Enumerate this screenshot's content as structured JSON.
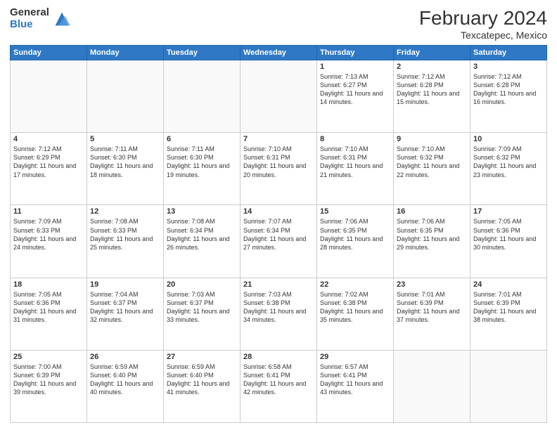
{
  "header": {
    "logo_general": "General",
    "logo_blue": "Blue",
    "month_title": "February 2024",
    "location": "Texcatepec, Mexico"
  },
  "weekdays": [
    "Sunday",
    "Monday",
    "Tuesday",
    "Wednesday",
    "Thursday",
    "Friday",
    "Saturday"
  ],
  "weeks": [
    [
      {
        "day": "",
        "sunrise": "",
        "sunset": "",
        "daylight": ""
      },
      {
        "day": "",
        "sunrise": "",
        "sunset": "",
        "daylight": ""
      },
      {
        "day": "",
        "sunrise": "",
        "sunset": "",
        "daylight": ""
      },
      {
        "day": "",
        "sunrise": "",
        "sunset": "",
        "daylight": ""
      },
      {
        "day": "1",
        "sunrise": "7:13 AM",
        "sunset": "6:27 PM",
        "daylight": "11 hours and 14 minutes."
      },
      {
        "day": "2",
        "sunrise": "7:12 AM",
        "sunset": "6:28 PM",
        "daylight": "11 hours and 15 minutes."
      },
      {
        "day": "3",
        "sunrise": "7:12 AM",
        "sunset": "6:28 PM",
        "daylight": "11 hours and 16 minutes."
      }
    ],
    [
      {
        "day": "4",
        "sunrise": "7:12 AM",
        "sunset": "6:29 PM",
        "daylight": "11 hours and 17 minutes."
      },
      {
        "day": "5",
        "sunrise": "7:11 AM",
        "sunset": "6:30 PM",
        "daylight": "11 hours and 18 minutes."
      },
      {
        "day": "6",
        "sunrise": "7:11 AM",
        "sunset": "6:30 PM",
        "daylight": "11 hours and 19 minutes."
      },
      {
        "day": "7",
        "sunrise": "7:10 AM",
        "sunset": "6:31 PM",
        "daylight": "11 hours and 20 minutes."
      },
      {
        "day": "8",
        "sunrise": "7:10 AM",
        "sunset": "6:31 PM",
        "daylight": "11 hours and 21 minutes."
      },
      {
        "day": "9",
        "sunrise": "7:10 AM",
        "sunset": "6:32 PM",
        "daylight": "11 hours and 22 minutes."
      },
      {
        "day": "10",
        "sunrise": "7:09 AM",
        "sunset": "6:32 PM",
        "daylight": "11 hours and 23 minutes."
      }
    ],
    [
      {
        "day": "11",
        "sunrise": "7:09 AM",
        "sunset": "6:33 PM",
        "daylight": "11 hours and 24 minutes."
      },
      {
        "day": "12",
        "sunrise": "7:08 AM",
        "sunset": "6:33 PM",
        "daylight": "11 hours and 25 minutes."
      },
      {
        "day": "13",
        "sunrise": "7:08 AM",
        "sunset": "6:34 PM",
        "daylight": "11 hours and 26 minutes."
      },
      {
        "day": "14",
        "sunrise": "7:07 AM",
        "sunset": "6:34 PM",
        "daylight": "11 hours and 27 minutes."
      },
      {
        "day": "15",
        "sunrise": "7:06 AM",
        "sunset": "6:35 PM",
        "daylight": "11 hours and 28 minutes."
      },
      {
        "day": "16",
        "sunrise": "7:06 AM",
        "sunset": "6:35 PM",
        "daylight": "11 hours and 29 minutes."
      },
      {
        "day": "17",
        "sunrise": "7:05 AM",
        "sunset": "6:36 PM",
        "daylight": "11 hours and 30 minutes."
      }
    ],
    [
      {
        "day": "18",
        "sunrise": "7:05 AM",
        "sunset": "6:36 PM",
        "daylight": "11 hours and 31 minutes."
      },
      {
        "day": "19",
        "sunrise": "7:04 AM",
        "sunset": "6:37 PM",
        "daylight": "11 hours and 32 minutes."
      },
      {
        "day": "20",
        "sunrise": "7:03 AM",
        "sunset": "6:37 PM",
        "daylight": "11 hours and 33 minutes."
      },
      {
        "day": "21",
        "sunrise": "7:03 AM",
        "sunset": "6:38 PM",
        "daylight": "11 hours and 34 minutes."
      },
      {
        "day": "22",
        "sunrise": "7:02 AM",
        "sunset": "6:38 PM",
        "daylight": "11 hours and 35 minutes."
      },
      {
        "day": "23",
        "sunrise": "7:01 AM",
        "sunset": "6:39 PM",
        "daylight": "11 hours and 37 minutes."
      },
      {
        "day": "24",
        "sunrise": "7:01 AM",
        "sunset": "6:39 PM",
        "daylight": "11 hours and 38 minutes."
      }
    ],
    [
      {
        "day": "25",
        "sunrise": "7:00 AM",
        "sunset": "6:39 PM",
        "daylight": "11 hours and 39 minutes."
      },
      {
        "day": "26",
        "sunrise": "6:59 AM",
        "sunset": "6:40 PM",
        "daylight": "11 hours and 40 minutes."
      },
      {
        "day": "27",
        "sunrise": "6:59 AM",
        "sunset": "6:40 PM",
        "daylight": "11 hours and 41 minutes."
      },
      {
        "day": "28",
        "sunrise": "6:58 AM",
        "sunset": "6:41 PM",
        "daylight": "11 hours and 42 minutes."
      },
      {
        "day": "29",
        "sunrise": "6:57 AM",
        "sunset": "6:41 PM",
        "daylight": "11 hours and 43 minutes."
      },
      {
        "day": "",
        "sunrise": "",
        "sunset": "",
        "daylight": ""
      },
      {
        "day": "",
        "sunrise": "",
        "sunset": "",
        "daylight": ""
      }
    ]
  ]
}
